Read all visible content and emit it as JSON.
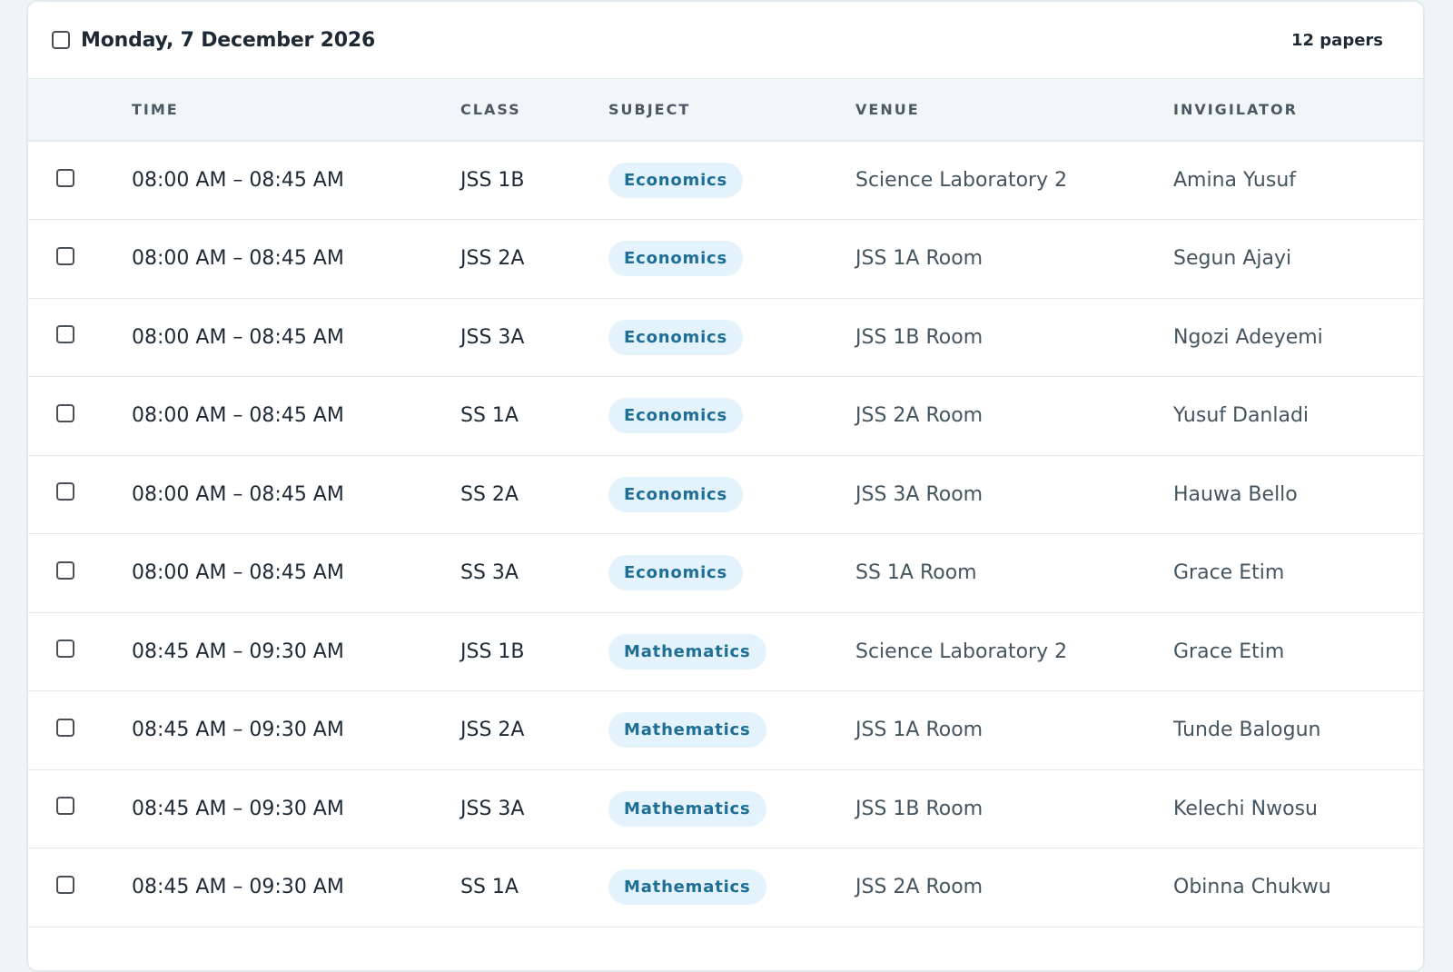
{
  "group": {
    "date": "Monday, 7 December 2026",
    "count": "12 papers"
  },
  "columns": {
    "time": "TIME",
    "class": "CLASS",
    "subject": "SUBJECT",
    "venue": "VENUE",
    "invigilator": "INVIGILATOR"
  },
  "rows": [
    {
      "time": "08:00 AM – 08:45 AM",
      "class": "JSS 1B",
      "subject": "Economics",
      "venue": "Science Laboratory 2",
      "invigilator": "Amina Yusuf"
    },
    {
      "time": "08:00 AM – 08:45 AM",
      "class": "JSS 2A",
      "subject": "Economics",
      "venue": "JSS 1A Room",
      "invigilator": "Segun Ajayi"
    },
    {
      "time": "08:00 AM – 08:45 AM",
      "class": "JSS 3A",
      "subject": "Economics",
      "venue": "JSS 1B Room",
      "invigilator": "Ngozi Adeyemi"
    },
    {
      "time": "08:00 AM – 08:45 AM",
      "class": "SS 1A",
      "subject": "Economics",
      "venue": "JSS 2A Room",
      "invigilator": "Yusuf Danladi"
    },
    {
      "time": "08:00 AM – 08:45 AM",
      "class": "SS 2A",
      "subject": "Economics",
      "venue": "JSS 3A Room",
      "invigilator": "Hauwa Bello"
    },
    {
      "time": "08:00 AM – 08:45 AM",
      "class": "SS 3A",
      "subject": "Economics",
      "venue": "SS 1A Room",
      "invigilator": "Grace Etim"
    },
    {
      "time": "08:45 AM – 09:30 AM",
      "class": "JSS 1B",
      "subject": "Mathematics",
      "venue": "Science Laboratory 2",
      "invigilator": "Grace Etim"
    },
    {
      "time": "08:45 AM – 09:30 AM",
      "class": "JSS 2A",
      "subject": "Mathematics",
      "venue": "JSS 1A Room",
      "invigilator": "Tunde Balogun"
    },
    {
      "time": "08:45 AM – 09:30 AM",
      "class": "JSS 3A",
      "subject": "Mathematics",
      "venue": "JSS 1B Room",
      "invigilator": "Kelechi Nwosu"
    },
    {
      "time": "08:45 AM – 09:30 AM",
      "class": "SS 1A",
      "subject": "Mathematics",
      "venue": "JSS 2A Room",
      "invigilator": "Obinna Chukwu"
    }
  ]
}
